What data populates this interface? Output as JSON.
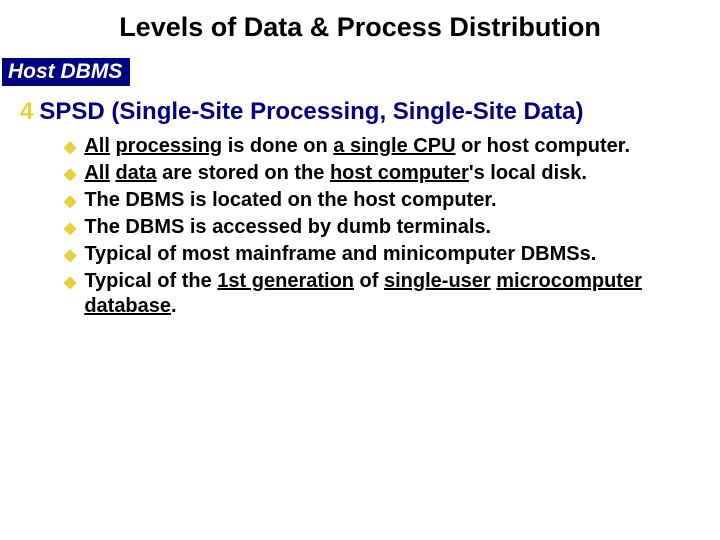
{
  "title": "Levels of Data & Process Distribution",
  "badge": "Host DBMS",
  "heading_icon": "4",
  "heading": "SPSD (Single-Site Processing, Single-Site Data)",
  "bullets": [
    "<span class='u'>All</span> <span class='u'>processing</span> is done on <span class='u'>a single CPU</span> or host computer.",
    "<span class='u'>All</span> <span class='u'>data</span> are stored on the <span class='u'>host computer</span>'s local disk.",
    "The DBMS is located on the host computer.",
    "The DBMS is accessed by dumb terminals.",
    "Typical of most mainframe and minicomputer DBMSs.",
    "Typical of the <span class='u'>1st generation</span> of <span class='u'>single-user</span> <span class='u'>microcomputer database</span>."
  ]
}
